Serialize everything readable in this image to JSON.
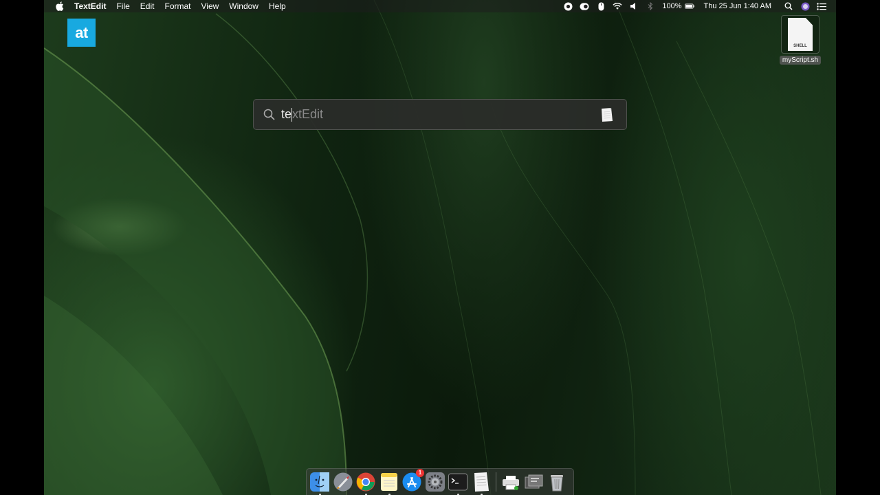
{
  "menubar": {
    "app_name": "TextEdit",
    "menus": [
      "File",
      "Edit",
      "Format",
      "View",
      "Window",
      "Help"
    ],
    "battery": "100%",
    "datetime": "Thu 25 Jun  1:40 AM"
  },
  "logo": {
    "text": "at"
  },
  "desktop_file": {
    "name": "myScript.sh",
    "label": "SHELL"
  },
  "spotlight": {
    "typed": "te",
    "completion": "xtEdit",
    "result_app_icon": "textedit-icon"
  },
  "dock": {
    "apps": [
      {
        "name": "finder-icon"
      },
      {
        "name": "launchpad-icon"
      },
      {
        "name": "chrome-icon"
      },
      {
        "name": "notes-icon"
      },
      {
        "name": "app-store-icon",
        "badge": "1"
      },
      {
        "name": "system-preferences-icon"
      },
      {
        "name": "terminal-icon"
      },
      {
        "name": "textedit-icon"
      }
    ],
    "trash": "trash-icon"
  },
  "colors": {
    "logo": "#18a9e0",
    "wallpaper_dark": "#0b1a0b",
    "wallpaper_light": "#2e5a2b"
  }
}
